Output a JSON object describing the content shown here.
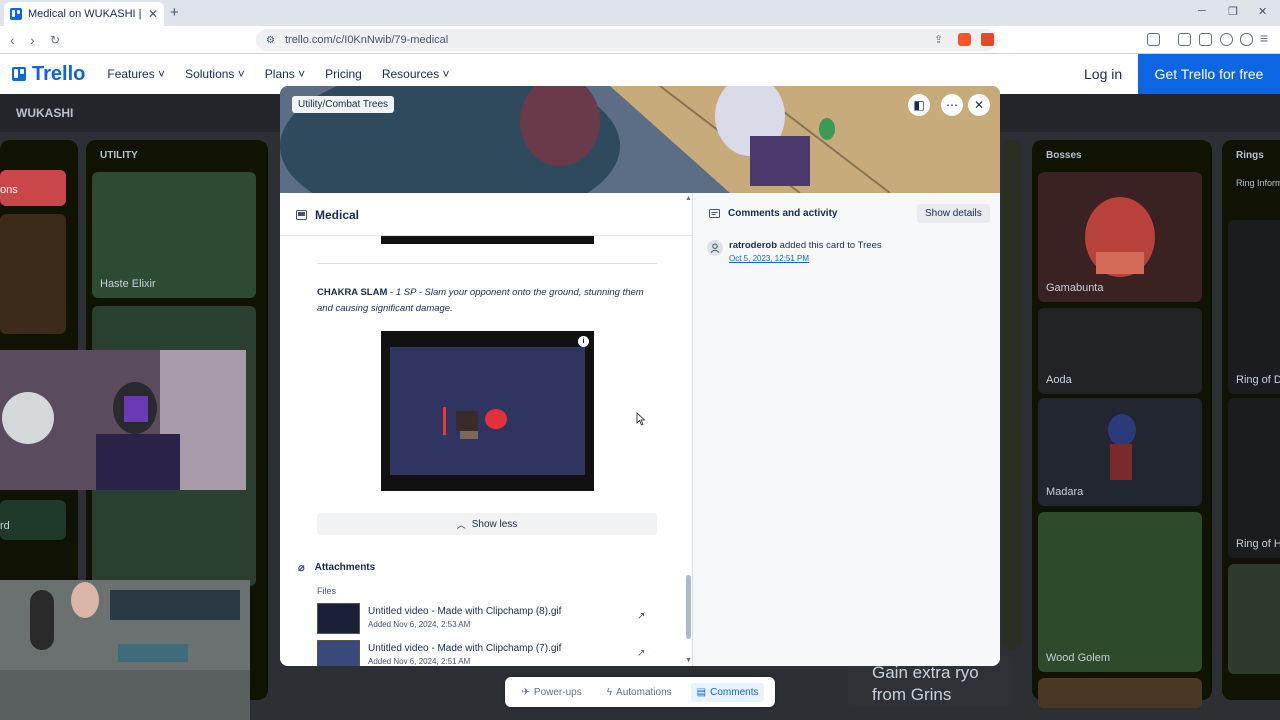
{
  "browser": {
    "tab_title": "Medical on WUKASHI | Trello",
    "tab_close": "✕",
    "new_tab": "+",
    "url": "trello.com/c/I0KnNwib/79-medical"
  },
  "marketing_nav": {
    "logo": "Trello",
    "items": [
      "Features",
      "Solutions",
      "Plans",
      "Pricing",
      "Resources"
    ],
    "login": "Log in",
    "cta": "Get Trello for free"
  },
  "board": {
    "name": "WUKASHI",
    "columns": {
      "utility": {
        "title": "UTILITY",
        "cards": [
          "Haste Elixir"
        ]
      },
      "bosses": {
        "title": "Bosses",
        "cards": [
          "Gamabunta",
          "Aoda",
          "Madara",
          "Wood Golem"
        ]
      },
      "rings": {
        "title": "Rings",
        "first_line": "Ring Inform",
        "cards": [
          "Ring of D",
          "Ring of H"
        ]
      }
    },
    "left_card_fragments": [
      "ons",
      "rd"
    ],
    "background_text": [
      "Gain extra ryo",
      "from Grins"
    ]
  },
  "modal": {
    "list_chip": "Utility/Combat Trees",
    "card_title": "Medical",
    "description": {
      "skill_name": "CHAKRA SLAM",
      "separator": " - ",
      "cost": "1 SP",
      "text": " - Slam your opponent onto the ground, stunning them and causing significant damage."
    },
    "gif_info": "i",
    "show_less": "Show less",
    "attachments": {
      "title": "Attachments",
      "files_label": "Files",
      "files": [
        {
          "name": "Untitled video - Made with Clipchamp (8).gif",
          "date": "Added Nov 6, 2024, 2:53 AM"
        },
        {
          "name": "Untitled video - Made with Clipchamp (7).gif",
          "date": "Added Nov 6, 2024, 2:51 AM"
        }
      ]
    },
    "activity": {
      "title": "Comments and activity",
      "show_details": "Show details",
      "user": "ratroderob",
      "action": " added this card to Trees",
      "date": "Oct 5, 2023, 12:51 PM"
    }
  },
  "bottom_toolbar": {
    "items": [
      "Power-ups",
      "Automations",
      "Comments"
    ],
    "active": "Comments"
  },
  "colors": {
    "brand": "#0c66e4",
    "board_bg": "#2c2f33",
    "modal_bg": "#ffffff"
  }
}
